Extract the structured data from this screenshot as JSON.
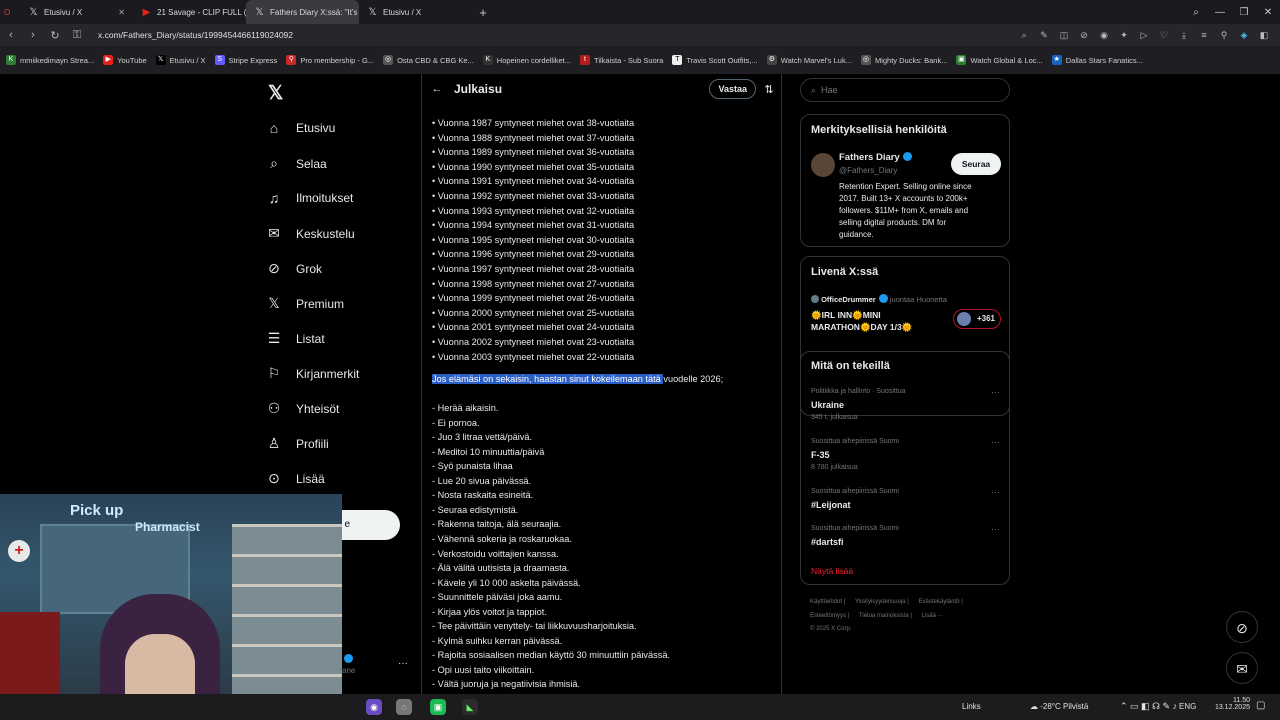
{
  "browser": {
    "tabs": [
      {
        "title": "Etusivu / X",
        "icon": "x-icon"
      },
      {
        "title": "21 Savage - CLIP FULL (OFF",
        "icon": "youtube-icon"
      },
      {
        "title": "Fathers Diary X:ssä: \"It's 20",
        "icon": "x-icon"
      },
      {
        "title": "Etusivu / X",
        "icon": "x-icon"
      }
    ],
    "new_tab_symbol": "+",
    "url": "x.com/Fathers_Diary/status/1999454466119024092",
    "bookmarks": [
      {
        "label": "mmiikedimayn Strea...",
        "color": "#2e7d32"
      },
      {
        "label": "YouTube",
        "color": "#e62117"
      },
      {
        "label": "Etusivu / X",
        "color": "#000000"
      },
      {
        "label": "Stripe Express",
        "color": "#635bff"
      },
      {
        "label": "Pro membership - G...",
        "color": "#c62828"
      },
      {
        "label": "Osta CBD & CBG Ke...",
        "color": "#555555"
      },
      {
        "label": "Hopeinen cordelliket...",
        "color": "#333333"
      },
      {
        "label": "Tilkaista - Sub Suora",
        "color": "#b71c1c"
      },
      {
        "label": "Travis Scott Outfits,...",
        "color": "#eeeeee"
      },
      {
        "label": "Watch Marvel's Luk...",
        "color": "#444444"
      },
      {
        "label": "Mighty Ducks: Bank...",
        "color": "#555555"
      },
      {
        "label": "Watch Global & Loc...",
        "color": "#2e7d32"
      },
      {
        "label": "Dallas Stars Fanatics...",
        "color": "#1565c0"
      }
    ]
  },
  "nav": {
    "items": [
      {
        "label": "Etusivu",
        "icon": "home-icon",
        "glyph": "⌂"
      },
      {
        "label": "Selaa",
        "icon": "search-icon",
        "glyph": "⌕"
      },
      {
        "label": "Ilmoitukset",
        "icon": "bell-icon",
        "glyph": "🔔︎"
      },
      {
        "label": "Keskustelu",
        "icon": "mail-icon",
        "glyph": "✉"
      },
      {
        "label": "Grok",
        "icon": "grok-icon",
        "glyph": "⊘"
      },
      {
        "label": "Premium",
        "icon": "x-premium-icon",
        "glyph": "𝕏"
      },
      {
        "label": "Listat",
        "icon": "list-icon",
        "glyph": "☰"
      },
      {
        "label": "Kirjanmerkit",
        "icon": "bookmark-icon",
        "glyph": "⚐"
      },
      {
        "label": "Yhteisöt",
        "icon": "communities-icon",
        "glyph": "⚇"
      },
      {
        "label": "Profiili",
        "icon": "profile-icon",
        "glyph": "♙"
      },
      {
        "label": "Lisää",
        "icon": "more-icon",
        "glyph": "⊙"
      }
    ],
    "post_button_fragment": "e",
    "profile_fragment": "ane"
  },
  "post": {
    "header_title": "Julkaisu",
    "reply_label": "Vastaa",
    "lines_top": [
      "• Vuonna 1987 syntyneet miehet ovat 38-vuotiaita",
      "• Vuonna 1988 syntyneet miehet ovat 37-vuotiaita",
      "• Vuonna 1989 syntyneet miehet ovat 36-vuotiaita",
      "• Vuonna 1990 syntyneet miehet ovat 35-vuotiaita",
      "• Vuonna 1991 syntyneet miehet ovat 34-vuotiaita",
      "• Vuonna 1992 syntyneet miehet ovat 33-vuotiaita",
      "• Vuonna 1993 syntyneet miehet ovat 32-vuotiaita",
      "• Vuonna 1994 syntyneet miehet ovat 31-vuotiaita",
      "• Vuonna 1995 syntyneet miehet ovat 30-vuotiaita",
      "• Vuonna 1996 syntyneet miehet ovat 29-vuotiaita",
      "• Vuonna 1997 syntyneet miehet ovat 28-vuotiaita",
      "• Vuonna 1998 syntyneet miehet ovat 27-vuotiaita",
      "• Vuonna 1999 syntyneet miehet ovat 26-vuotiaita",
      "• Vuonna 2000 syntyneet miehet ovat 25-vuotiaita",
      "• Vuonna 2001 syntyneet miehet ovat 24-vuotiaita",
      "• Vuonna 2002 syntyneet miehet ovat 23-vuotiaita",
      "• Vuonna 2003 syntyneet miehet ovat 22-vuotiaita"
    ],
    "highlight_text": "Jos elämäsi on sekaisin, haastan sinut kokeilemaan tätä ",
    "highlight_rest": "uodelle 2026;",
    "cursor_char": "v",
    "lines_bottom": [
      "- Herää aikaisin.",
      "- Ei pornoa.",
      "- Juo 3 litraa vettä/päivä.",
      "- Meditoi 10 minuuttia/päivä",
      "- Syö punaista lihaa",
      "- Lue 20 sivua päivässä.",
      "- Nosta raskaita esineitä.",
      "- Seuraa edistymistä.",
      "- Rakenna taitoja, älä seuraajia.",
      "- Vähennä sokeria ja roskaruokaa.",
      "- Verkostoidu voittajien kanssa.",
      "- Älä välitä uutisista ja draamasta.",
      "- Kävele yli 10 000 askelta päivässä.",
      "- Suunnittele päiväsi joka aamu.",
      "- Kirjaa ylös voitot ja tappiot.",
      "- Tee päivittäin venyttely- tai liikkuvuusharjoituksia.",
      "- Kylmä suihku kerran päivässä.",
      "- Rajoita sosiaalisen median käyttö 30 minuuttiin päivässä.",
      "- Opi uusi taito viikoittain.",
      "- Vältä juoruja ja negatiivisia ihmisiä."
    ]
  },
  "right": {
    "search_placeholder": "Hae",
    "relevant_title": "Merkityksellisiä henkilöitä",
    "person_name": "Fathers Diary",
    "person_handle": "@Fathers_Diary",
    "follow_label": "Seuraa",
    "person_bio": [
      "Retention Expert. Selling online since",
      "2017. Built 13+ X accounts to 200k+",
      "followers. $11M+ from X, emails and",
      "selling digital products. DM for",
      "guidance."
    ],
    "live_title": "Livenä X:ssä",
    "live_host": "OfficeDrummer",
    "live_hosting": "juontaa Huonetta",
    "live_line1": "🌞IRL INN🌞MINI",
    "live_line2": "MARATHON🌞DAY 1/3🌞",
    "live_count": "+361",
    "trends_title": "Mitä on tekeillä",
    "trends": [
      {
        "meta": "Politiikka ja hallinto · Suosittua",
        "name": "Ukraine",
        "count": "345 t. julkaisua"
      },
      {
        "meta": "Suosittua aihepiirissä Suomi",
        "name": "F-35",
        "count": "8 780 julkaisua"
      },
      {
        "meta": "Suosittua aihepiirissä Suomi",
        "name": "#Leijonat",
        "count": ""
      },
      {
        "meta": "Suosittua aihepiirissä Suomi",
        "name": "#dartsfi",
        "count": ""
      }
    ],
    "show_more": "Näytä lisää",
    "more_symbol": "···",
    "footer_line1": [
      "Käyttöehdot",
      "Yksityisyydensuoja",
      "Evästekäytäntö"
    ],
    "footer_line2": [
      "Esteettömyys",
      "Tietoa mainoksista",
      "Lisää ···"
    ],
    "footer_copy": "© 2025 X Corp."
  },
  "webcam": {
    "sign1": "Pick up",
    "sign2": "Pharmacist"
  },
  "taskbar": {
    "links_label": "Links",
    "weather": "-28°C Pilvistä",
    "lang": "ENG",
    "time": "11.50",
    "date": "13.12.2025"
  }
}
